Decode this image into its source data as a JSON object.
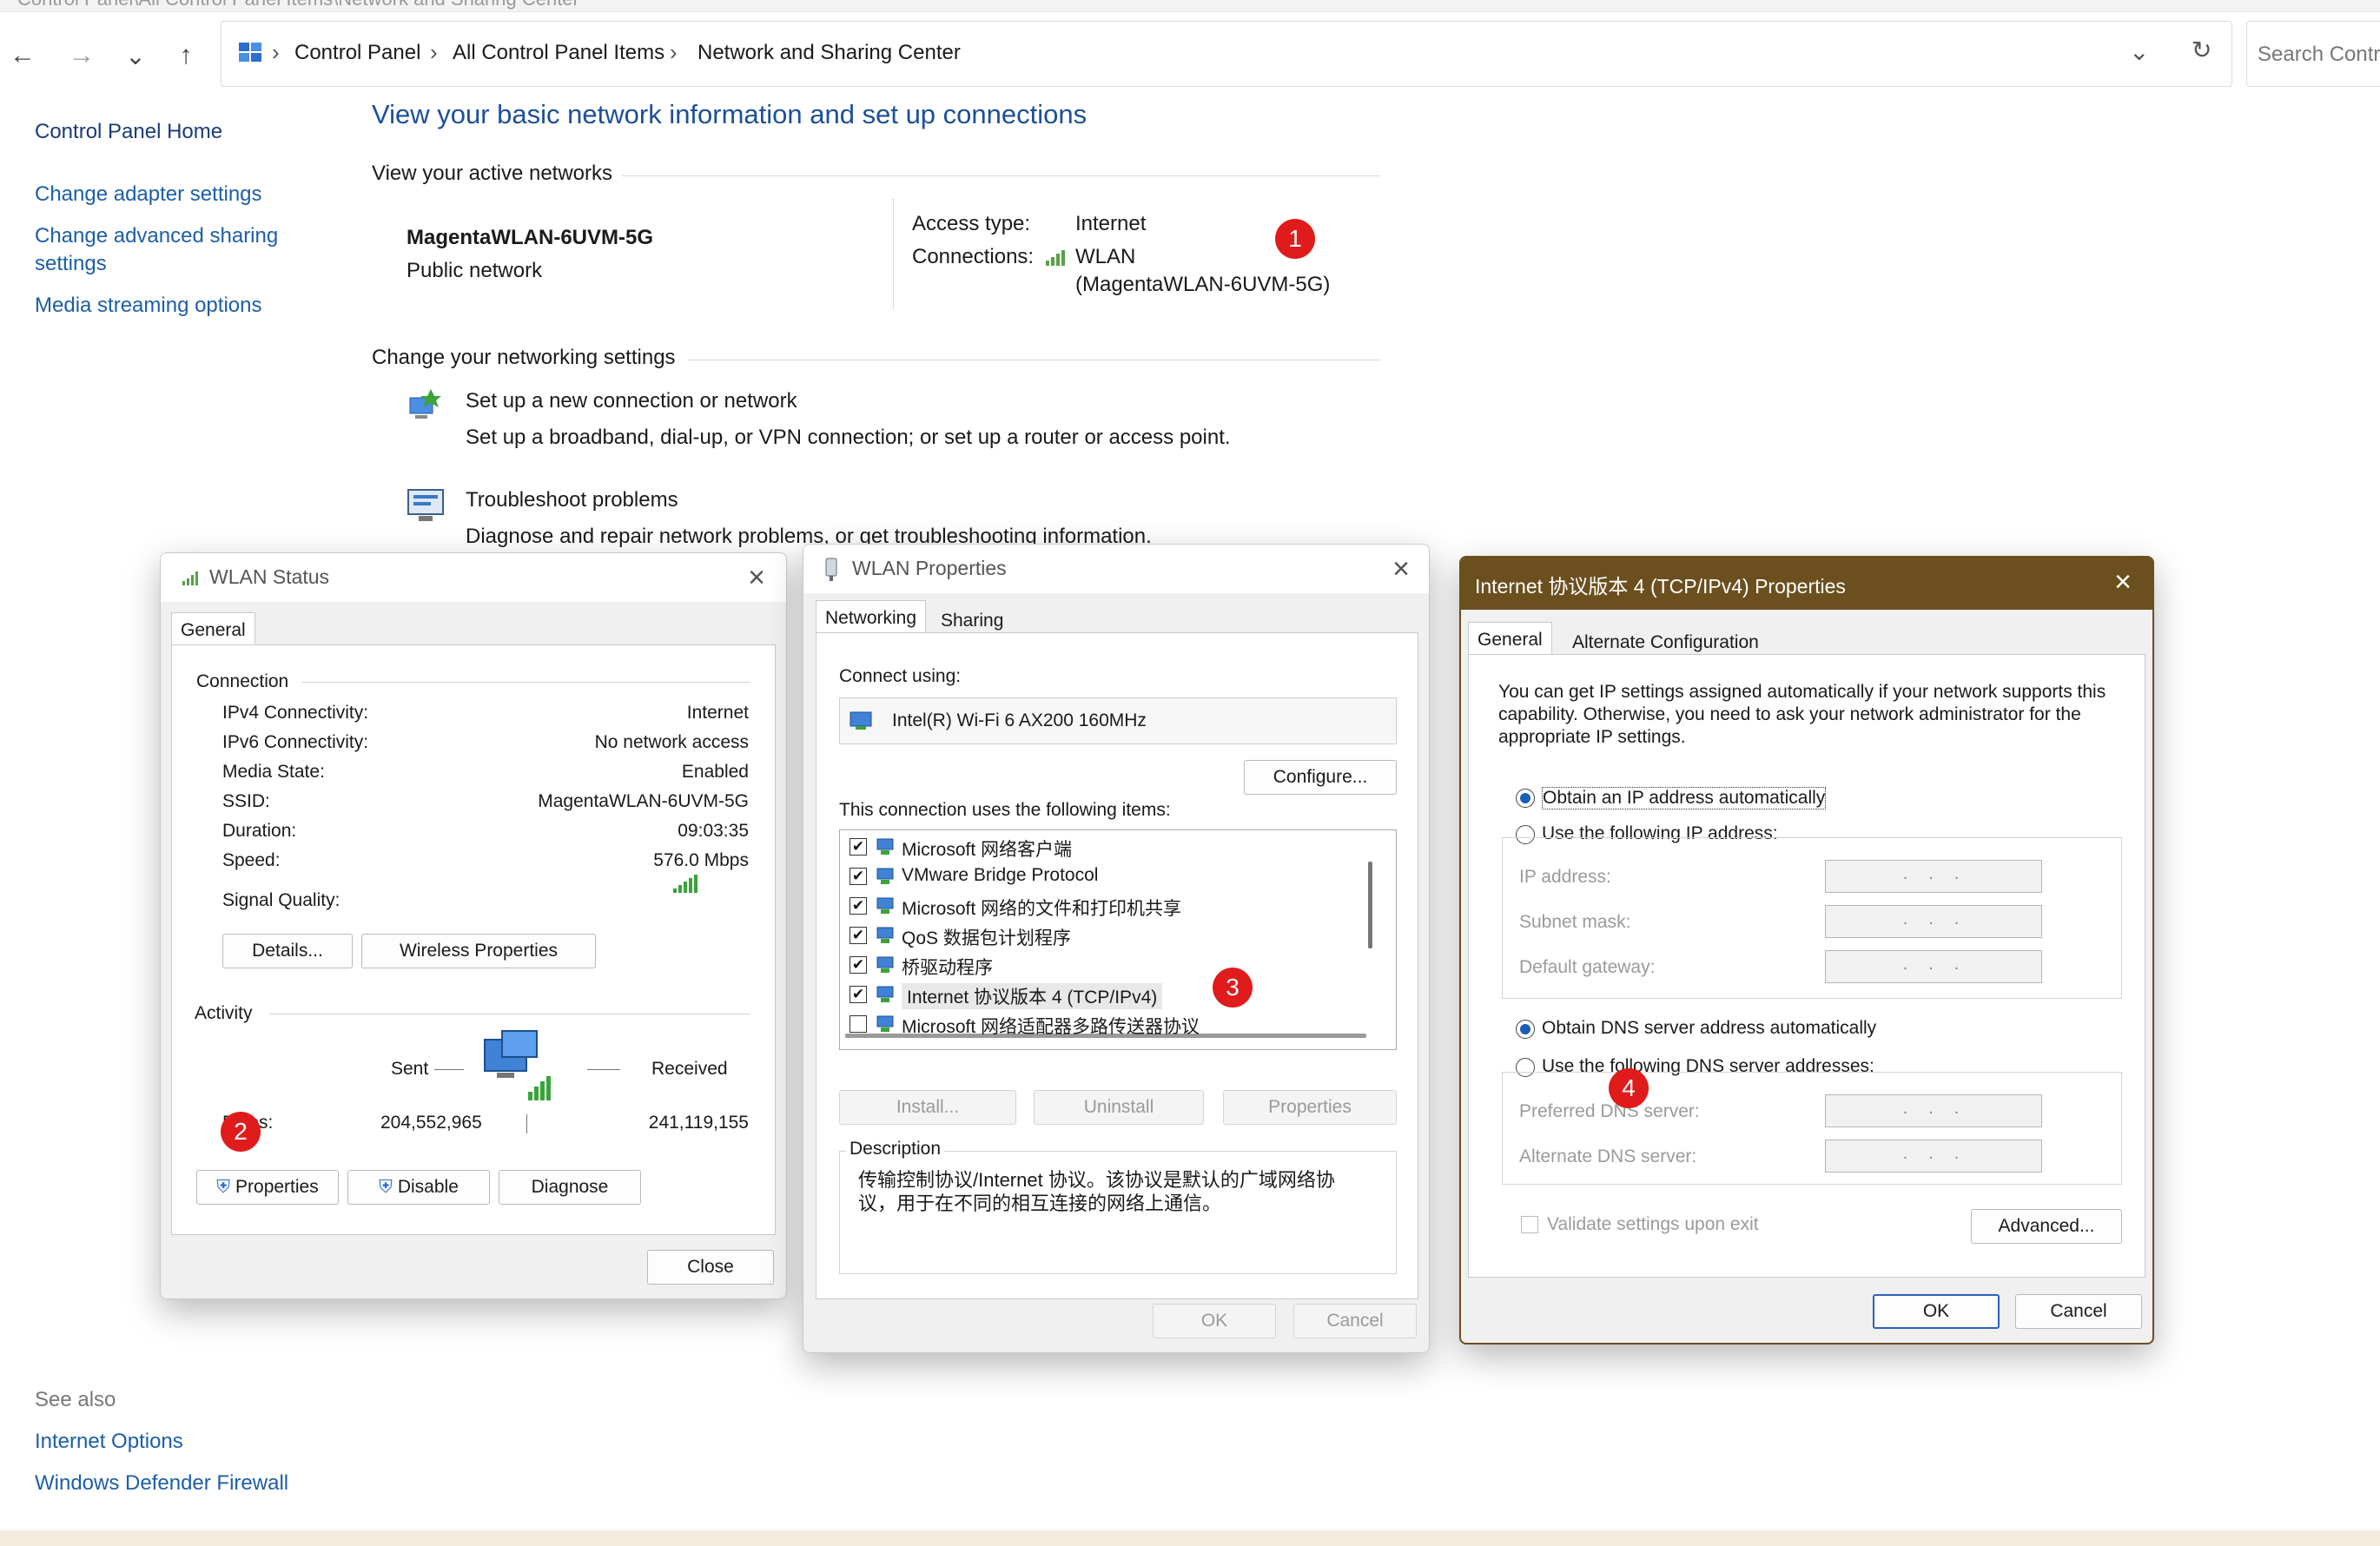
{
  "window": {
    "title_strip": "Control Panel\\All Control Panel Items\\Network and Sharing Center"
  },
  "nav": {
    "back_icon": "←",
    "forward_icon": "→",
    "recent_icon": "⌄",
    "up_icon": "↑",
    "crumbs": [
      "Control Panel",
      "All Control Panel Items",
      "Network and Sharing Center"
    ],
    "dropdown_icon": "⌄",
    "refresh_icon": "↻",
    "search_placeholder": "Search Contr"
  },
  "sidebar": {
    "home": "Control Panel Home",
    "links": [
      "Change adapter settings",
      "Change advanced sharing settings",
      "Media streaming options"
    ],
    "see_also_title": "See also",
    "see_also": [
      "Internet Options",
      "Windows Defender Firewall"
    ]
  },
  "main": {
    "heading": "View your basic network information and set up connections",
    "active_networks_label": "View your active networks",
    "network_name": "MagentaWLAN-6UVM-5G",
    "network_type": "Public network",
    "access_type_label": "Access type:",
    "access_type_value": "Internet",
    "connections_label": "Connections:",
    "connection_link_line1": "WLAN",
    "connection_link_line2": "(MagentaWLAN-6UVM-5G)",
    "change_settings_label": "Change your networking settings",
    "setup_link": "Set up a new connection or network",
    "setup_desc": "Set up a broadband, dial-up, or VPN connection; or set up a router or access point.",
    "troubleshoot_link": "Troubleshoot problems",
    "troubleshoot_desc": "Diagnose and repair network problems, or get troubleshooting information."
  },
  "wlan_status": {
    "title": "WLAN Status",
    "tab": "General",
    "connection_group": "Connection",
    "rows": [
      {
        "label": "IPv4 Connectivity:",
        "value": "Internet"
      },
      {
        "label": "IPv6 Connectivity:",
        "value": "No network access"
      },
      {
        "label": "Media State:",
        "value": "Enabled"
      },
      {
        "label": "SSID:",
        "value": "MagentaWLAN-6UVM-5G"
      },
      {
        "label": "Duration:",
        "value": "09:03:35"
      },
      {
        "label": "Speed:",
        "value": "576.0 Mbps"
      }
    ],
    "signal_label": "Signal Quality:",
    "details_btn": "Details...",
    "wireless_btn": "Wireless Properties",
    "activity_group": "Activity",
    "sent_label": "Sent",
    "received_label": "Received",
    "bytes_label": "Bytes:",
    "bytes_sent": "204,552,965",
    "bytes_received": "241,119,155",
    "properties_btn": "Properties",
    "disable_btn": "Disable",
    "diagnose_btn": "Diagnose",
    "close_btn": "Close"
  },
  "wlan_props": {
    "title": "WLAN Properties",
    "tabs": [
      "Networking",
      "Sharing"
    ],
    "connect_using_label": "Connect using:",
    "adapter": "Intel(R) Wi-Fi 6 AX200 160MHz",
    "configure_btn": "Configure...",
    "items_label": "This connection uses the following items:",
    "items": [
      {
        "label": "Microsoft 网络客户端",
        "checked": "✔"
      },
      {
        "label": "VMware Bridge Protocol",
        "checked": "✔"
      },
      {
        "label": "Microsoft 网络的文件和打印机共享",
        "checked": "✔"
      },
      {
        "label": "QoS 数据包计划程序",
        "checked": "✔"
      },
      {
        "label": "桥驱动程序",
        "checked": "✔"
      },
      {
        "label": "Internet 协议版本 4 (TCP/IPv4)",
        "checked": "✔"
      },
      {
        "label": "Microsoft 网络适配器多路传送器协议",
        "checked": ""
      }
    ],
    "install_btn": "Install...",
    "uninstall_btn": "Uninstall",
    "properties_btn": "Properties",
    "description_label": "Description",
    "description_text": "传输控制协议/Internet 协议。该协议是默认的广域网络协议，用于在不同的相互连接的网络上通信。",
    "ok_btn": "OK",
    "cancel_btn": "Cancel"
  },
  "ipv4_props": {
    "title": "Internet 协议版本 4 (TCP/IPv4) Properties",
    "tabs": [
      "General",
      "Alternate Configuration"
    ],
    "intro": "You can get IP settings assigned automatically if your network supports this capability. Otherwise, you need to ask your network administrator for the appropriate IP settings.",
    "obtain_ip_auto": "Obtain an IP address automatically",
    "use_following_ip": "Use the following IP address:",
    "ip_address_label": "IP address:",
    "subnet_label": "Subnet mask:",
    "gateway_label": "Default gateway:",
    "ip_placeholder": "...",
    "obtain_dns_auto": "Obtain DNS server address automatically",
    "use_following_dns": "Use the following DNS server addresses:",
    "preferred_dns_label": "Preferred DNS server:",
    "alternate_dns_label": "Alternate DNS server:",
    "validate_label": "Validate settings upon exit",
    "advanced_btn": "Advanced...",
    "ok_btn": "OK",
    "cancel_btn": "Cancel",
    "title_bar_color": "#6b4f1e"
  },
  "annotations": [
    "1",
    "2",
    "3",
    "4"
  ],
  "colors": {
    "link": "#1c5ea8",
    "badge": "#e01b1b",
    "radio_on": "#1a5fb4"
  }
}
